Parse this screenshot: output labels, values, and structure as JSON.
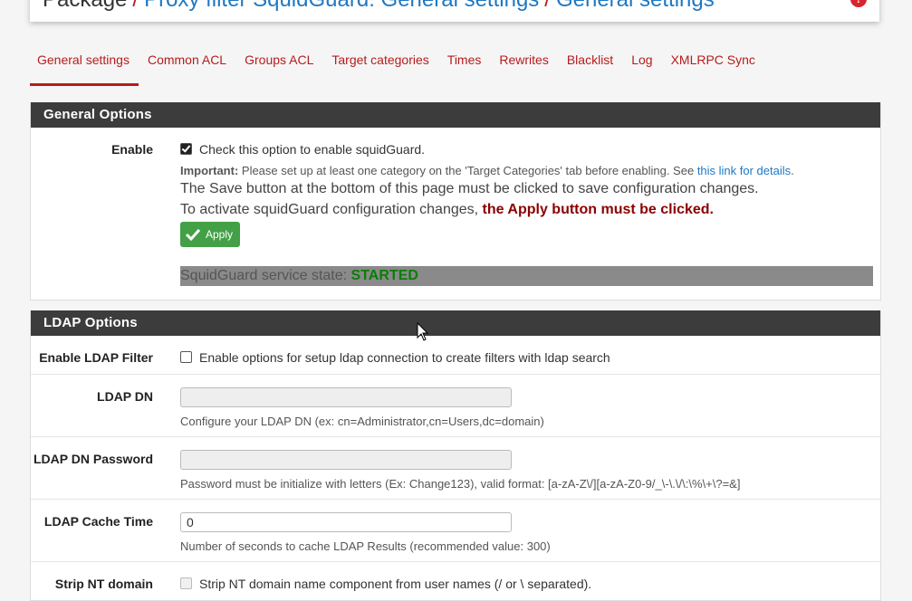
{
  "header": {
    "root": "Package",
    "crumb1": "Proxy filter SquidGuard: General settings",
    "crumb2": "General settings",
    "help_glyph": "?"
  },
  "tabs": [
    {
      "label": "General settings",
      "active": true
    },
    {
      "label": "Common ACL"
    },
    {
      "label": "Groups ACL"
    },
    {
      "label": "Target categories"
    },
    {
      "label": "Times"
    },
    {
      "label": "Rewrites"
    },
    {
      "label": "Blacklist"
    },
    {
      "label": "Log"
    },
    {
      "label": "XMLRPC Sync"
    }
  ],
  "general": {
    "heading": "General Options",
    "enable_label": "Enable",
    "enable_text": "Check this option to enable squidGuard.",
    "enable_checked": true,
    "important_label": "Important:",
    "important_text": " Please set up at least one category on the 'Target Categories' tab before enabling. See ",
    "important_link": "this link for details",
    "important_end": ".",
    "save_note": "The Save button at the bottom of this page must be clicked to save configuration changes.",
    "activate_note": "To activate squidGuard configuration changes, ",
    "activate_emph": "the Apply button must be clicked.",
    "apply_button": "Apply",
    "service_state_label": "SquidGuard service state: ",
    "service_state_value": "STARTED"
  },
  "ldap": {
    "heading": "LDAP Options",
    "enable_label": "Enable LDAP Filter",
    "enable_text": "Enable options for setup ldap connection to create filters with ldap search",
    "dn_label": "LDAP DN",
    "dn_value": "",
    "dn_help": "Configure your LDAP DN (ex: cn=Administrator,cn=Users,dc=domain)",
    "pw_label": "LDAP DN Password",
    "pw_value": "",
    "pw_help": "Password must be initialize with letters (Ex: Change123), valid format: [a-zA-Z\\/][a-zA-Z0-9/_\\-\\.\\/\\:\\%\\+\\?=&]",
    "cache_label": "LDAP Cache Time",
    "cache_value": "0",
    "cache_help": "Number of seconds to cache LDAP Results (recommended value: 300)",
    "strip_label": "Strip NT domain",
    "strip_text": "Strip NT domain name component from user names (/ or \\ separated)."
  }
}
